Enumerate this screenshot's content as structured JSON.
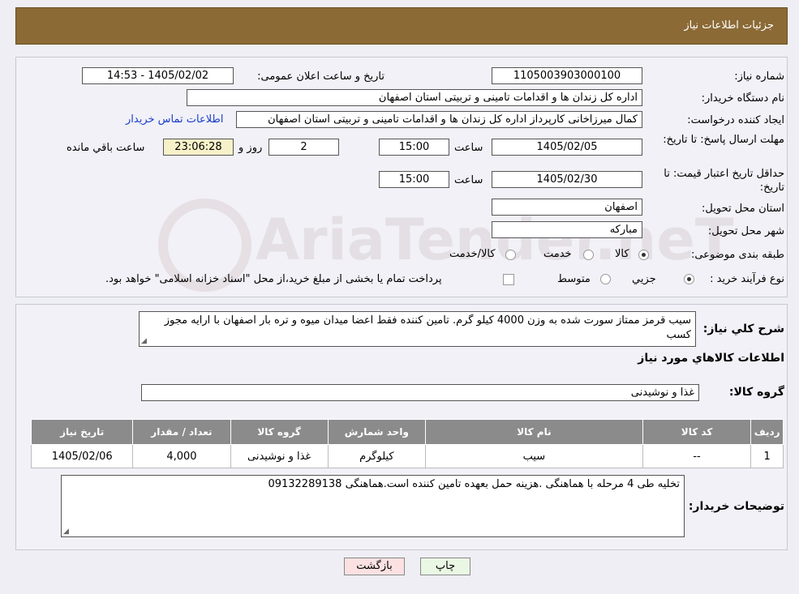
{
  "header": {
    "title": "جزئیات اطلاعات نیاز"
  },
  "watermark": {
    "text": "AriaTender.neT"
  },
  "form": {
    "need_number_label": "شماره نیاز:",
    "need_number": "1105003903000100",
    "announce_label": "تاریخ و ساعت اعلان عمومی:",
    "announce_value": "1405/02/02 - 14:53",
    "buyer_org_label": "نام دستگاه خریدار:",
    "buyer_org": "اداره کل زندان ها و اقدامات تامینی و تربیتی استان اصفهان",
    "creator_label": "ایجاد کننده درخواست:",
    "creator": "کمال میرزاخانی کارپرداز اداره کل زندان ها و اقدامات تامینی و تربیتی استان اصفهان",
    "contact_link": "اطلاعات تماس خریدار",
    "deadline_label": "مهلت ارسال پاسخ: تا تاریخ:",
    "deadline_date": "1405/02/05",
    "time_label": "ساعت",
    "deadline_time": "15:00",
    "days_value": "2",
    "days_label": "روز و",
    "remaining_time": "23:06:28",
    "remaining_label": "ساعت باقي مانده",
    "validity_label": "حداقل تاریخ اعتبار قیمت: تا تاریخ:",
    "validity_date": "1405/02/30",
    "validity_time": "15:00",
    "province_label": "استان محل تحویل:",
    "province": "اصفهان",
    "city_label": "شهر محل تحویل:",
    "city": "مبارکه",
    "category_label": "طبقه بندی موضوعی:",
    "category_options": [
      "کالا",
      "خدمت",
      "کالا/خدمت"
    ],
    "process_label": "نوع فرآیند خرید :",
    "process_options": [
      "جزیي",
      "متوسط"
    ],
    "process_note": "پرداخت تمام یا بخشی از مبلغ خرید،از محل \"اسناد خزانه اسلامی\" خواهد بود."
  },
  "summary": {
    "desc_label": "شرح کلي نياز:",
    "description": "سیب قرمز ممتاز سورت شده به وزن 4000 کیلو گرم.  تامین کننده فقط اعضا میدان میوه و تره بار اصفهان با ارایه مجوز کسب",
    "goods_info_title": "اطلاعات کالاهاي مورد نياز",
    "goods_group_label": "گروه کالا:",
    "goods_group": "غذا و نوشیدنی",
    "table": {
      "headers": [
        "رديف",
        "کد کالا",
        "نام کالا",
        "واحد شمارش",
        "گروه کالا",
        "تعداد / مقدار",
        "تاریخ نیاز"
      ],
      "rows": [
        [
          "1",
          "--",
          "سیب",
          "کیلوگرم",
          "غذا و نوشیدنی",
          "4,000",
          "1405/02/06"
        ]
      ]
    },
    "buyer_notes_label": "توضیحات خریدار:",
    "buyer_notes": "تخلیه طی 4 مرحله با هماهنگی .هزینه حمل بعهده تامین کننده است.هماهنگی 09132289138"
  },
  "buttons": {
    "print": "چاپ",
    "back": "بازگشت"
  }
}
